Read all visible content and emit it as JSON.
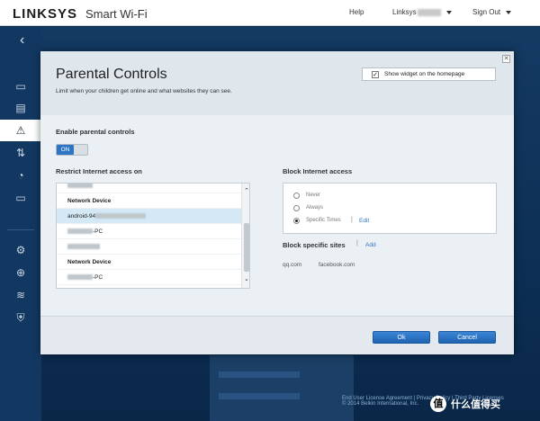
{
  "header": {
    "brand": "LINKSYS",
    "product": "Smart Wi-Fi",
    "help": "Help",
    "account": "Linksys",
    "sign_out": "Sign Out"
  },
  "footer": {
    "links": "End User License Agreement | Privacy Policy | Third Party Licenses",
    "copyright": "© 2014 Belkin International, Inc."
  },
  "modal": {
    "title": "Parental Controls",
    "subtitle": "Limit when your children get online and what websites they can see.",
    "widget_label": "Show widget on the homepage",
    "widget_checked": true,
    "enable_label": "Enable parental controls",
    "toggle_label": "ON",
    "restrict_label": "Restrict Internet access on",
    "block_label": "Block Internet access",
    "block_sites_label": "Block specific sites",
    "add_link": "Add",
    "edit_link": "Edit",
    "ok_button": "Ok",
    "cancel_button": "Cancel"
  },
  "devices": [
    {
      "label": "",
      "type": "device"
    },
    {
      "label": "Network Device",
      "type": "header"
    },
    {
      "label": "android-94",
      "type": "device",
      "selected": true
    },
    {
      "label": "-PC",
      "type": "device"
    },
    {
      "label": "",
      "type": "device"
    },
    {
      "label": "Network Device",
      "type": "header"
    },
    {
      "label": "-PC",
      "type": "device"
    }
  ],
  "block_options": [
    {
      "label": "Never",
      "selected": false
    },
    {
      "label": "Always",
      "selected": false
    },
    {
      "label": "Specific Times",
      "selected": true
    }
  ],
  "blocked_sites": [
    "qq.com",
    "facebook.com"
  ],
  "watermark": {
    "symbol": "值",
    "text": "什么值得买"
  }
}
